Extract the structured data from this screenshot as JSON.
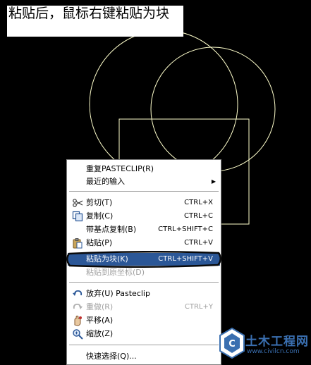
{
  "caption": {
    "text": "粘贴后，鼠标右键粘贴为块"
  },
  "context_menu": {
    "items": [
      {
        "label": "重复PASTECLIP(R)",
        "shortcut": "",
        "icon": "",
        "state": "normal"
      },
      {
        "label": "最近的输入",
        "shortcut": "",
        "icon": "",
        "state": "normal",
        "submenu": true
      },
      {
        "label": "剪切(T)",
        "shortcut": "CTRL+X",
        "icon": "scissors-icon",
        "state": "normal"
      },
      {
        "label": "复制(C)",
        "shortcut": "CTRL+C",
        "icon": "copy-icon",
        "state": "normal"
      },
      {
        "label": "带基点复制(B)",
        "shortcut": "CTRL+SHIFT+C",
        "icon": "",
        "state": "normal"
      },
      {
        "label": "粘贴(P)",
        "shortcut": "CTRL+V",
        "icon": "paste-icon",
        "state": "normal"
      },
      {
        "label": "粘贴为块(K)",
        "shortcut": "CTRL+SHIFT+V",
        "icon": "",
        "state": "selected"
      },
      {
        "label": "粘贴到原坐标(D)",
        "shortcut": "",
        "icon": "",
        "state": "disabled"
      },
      {
        "label": "放弃(U) Pasteclip",
        "shortcut": "",
        "icon": "undo-icon",
        "state": "normal"
      },
      {
        "label": "重做(R)",
        "shortcut": "CTRL+Y",
        "icon": "redo-icon",
        "state": "disabled"
      },
      {
        "label": "平移(A)",
        "shortcut": "",
        "icon": "pan-icon",
        "state": "normal"
      },
      {
        "label": "缩放(Z)",
        "shortcut": "",
        "icon": "zoom-icon",
        "state": "normal"
      },
      {
        "label": "快速选择(Q)...",
        "shortcut": "",
        "icon": "",
        "state": "normal"
      }
    ],
    "submenu_arrow": "▶"
  },
  "watermark": {
    "name": "土木工程网",
    "url": "www.civilcn.com"
  },
  "colors": {
    "background": "#000000",
    "geometry_stroke": "#ffffcc",
    "menu_highlight": "#2b5797",
    "disabled_text": "#a0a0a0",
    "watermark_blue": "#3a6fb0"
  }
}
